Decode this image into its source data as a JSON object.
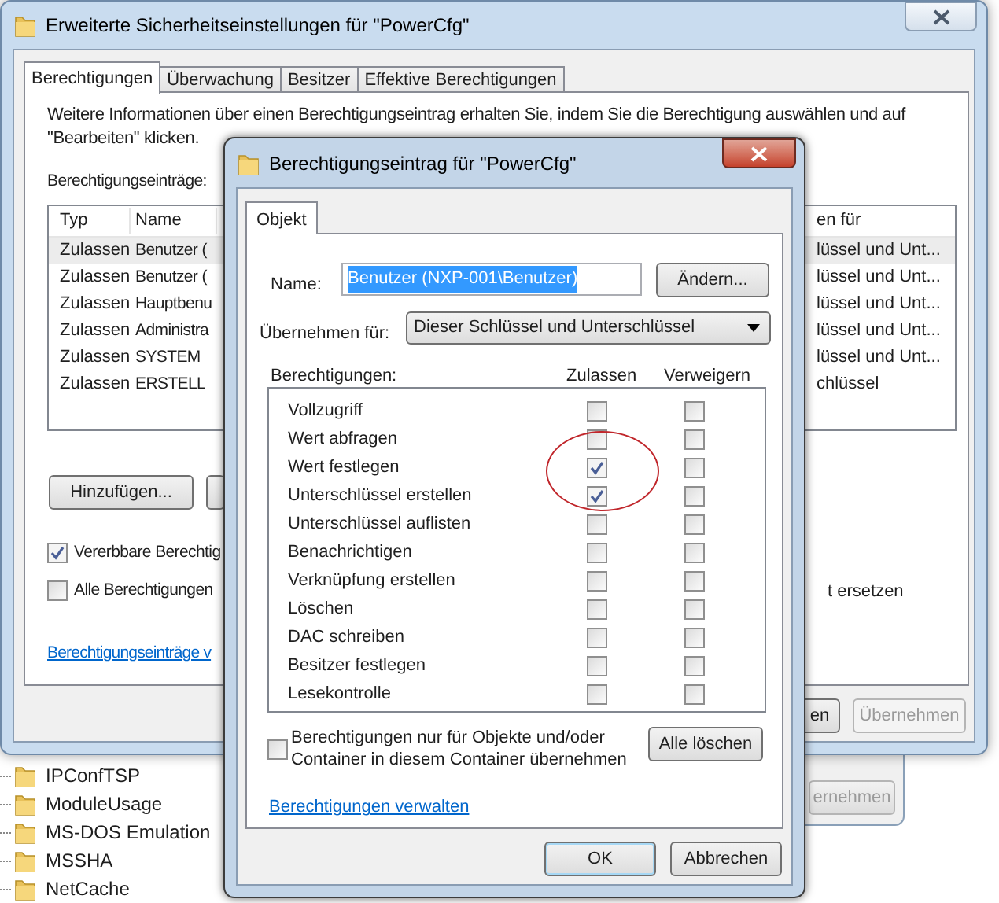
{
  "registry_tree": {
    "items": [
      {
        "label": "IPConfTSP"
      },
      {
        "label": "ModuleUsage"
      },
      {
        "label": "MS-DOS Emulation"
      },
      {
        "label": "MSSHA"
      },
      {
        "label": "NetCache"
      }
    ]
  },
  "rear_window": {
    "button": {
      "label": "ernehmen",
      "disabled": true
    }
  },
  "main_window": {
    "title": "Erweiterte Sicherheitseinstellungen für \"PowerCfg\"",
    "tabs": [
      {
        "label": "Berechtigungen",
        "selected": true
      },
      {
        "label": "Überwachung",
        "selected": false
      },
      {
        "label": "Besitzer",
        "selected": false
      },
      {
        "label": "Effektive Berechtigungen",
        "selected": false
      }
    ],
    "info_text": "Weitere Informationen über einen Berechtigungseintrag erhalten Sie, indem Sie die Berechtigung auswählen und auf \"Bearbeiten\" klicken.",
    "entries_label": "Berechtigungseinträge:",
    "table": {
      "columns": [
        "Typ",
        "Name",
        "en für"
      ],
      "rows": [
        {
          "cells": [
            "Zulassen",
            "Benutzer (",
            "lüssel und Unt..."
          ],
          "selected": true
        },
        {
          "cells": [
            "Zulassen",
            "Benutzer (",
            "lüssel und Unt..."
          ],
          "selected": false
        },
        {
          "cells": [
            "Zulassen",
            "Hauptbenu",
            "lüssel und Unt..."
          ],
          "selected": false
        },
        {
          "cells": [
            "Zulassen",
            "Administra",
            "lüssel und Unt..."
          ],
          "selected": false
        },
        {
          "cells": [
            "Zulassen",
            "SYSTEM",
            "lüssel und Unt..."
          ],
          "selected": false
        },
        {
          "cells": [
            "Zulassen",
            "ERSTELL",
            "chlüssel"
          ],
          "selected": false
        }
      ]
    },
    "add_button": "Hinzufügen...",
    "checkboxes": [
      {
        "label": "Vererbbare Berechtig",
        "checked": true
      },
      {
        "label": "Alle Berechtigungen",
        "checked": false,
        "right_text": "t ersetzen"
      }
    ],
    "link": "Berechtigungseinträge v",
    "footer_buttons": [
      {
        "label": "en",
        "disabled": false
      },
      {
        "label": "Übernehmen",
        "disabled": true
      }
    ]
  },
  "dialog": {
    "title": "Berechtigungseintrag für \"PowerCfg\"",
    "tabs": [
      {
        "label": "Objekt",
        "selected": true
      }
    ],
    "name_label": "Name:",
    "name_value": "Benutzer (NXP-001\\Benutzer)",
    "change_button": "Ändern...",
    "apply_label": "Übernehmen für:",
    "apply_value": "Dieser Schlüssel und Unterschlüssel",
    "permissions_label": "Berechtigungen:",
    "allow_header": "Zulassen",
    "deny_header": "Verweigern",
    "permissions": [
      {
        "label": "Vollzugriff",
        "allow": false,
        "deny": false
      },
      {
        "label": "Wert abfragen",
        "allow": false,
        "deny": false
      },
      {
        "label": "Wert festlegen",
        "allow": true,
        "deny": false
      },
      {
        "label": "Unterschlüssel erstellen",
        "allow": true,
        "deny": false
      },
      {
        "label": "Unterschlüssel auflisten",
        "allow": false,
        "deny": false
      },
      {
        "label": "Benachrichtigen",
        "allow": false,
        "deny": false
      },
      {
        "label": "Verknüpfung erstellen",
        "allow": false,
        "deny": false
      },
      {
        "label": "Löschen",
        "allow": false,
        "deny": false
      },
      {
        "label": "DAC schreiben",
        "allow": false,
        "deny": false
      },
      {
        "label": "Besitzer festlegen",
        "allow": false,
        "deny": false
      },
      {
        "label": "Lesekontrolle",
        "allow": false,
        "deny": false
      }
    ],
    "inherit_checkbox": {
      "label": "Berechtigungen nur für Objekte und/oder Container in diesem Container übernehmen",
      "checked": false
    },
    "clear_button": "Alle löschen",
    "link": "Berechtigungen verwalten",
    "buttons": [
      {
        "label": "OK",
        "default": true
      },
      {
        "label": "Abbrechen",
        "default": false
      }
    ]
  }
}
